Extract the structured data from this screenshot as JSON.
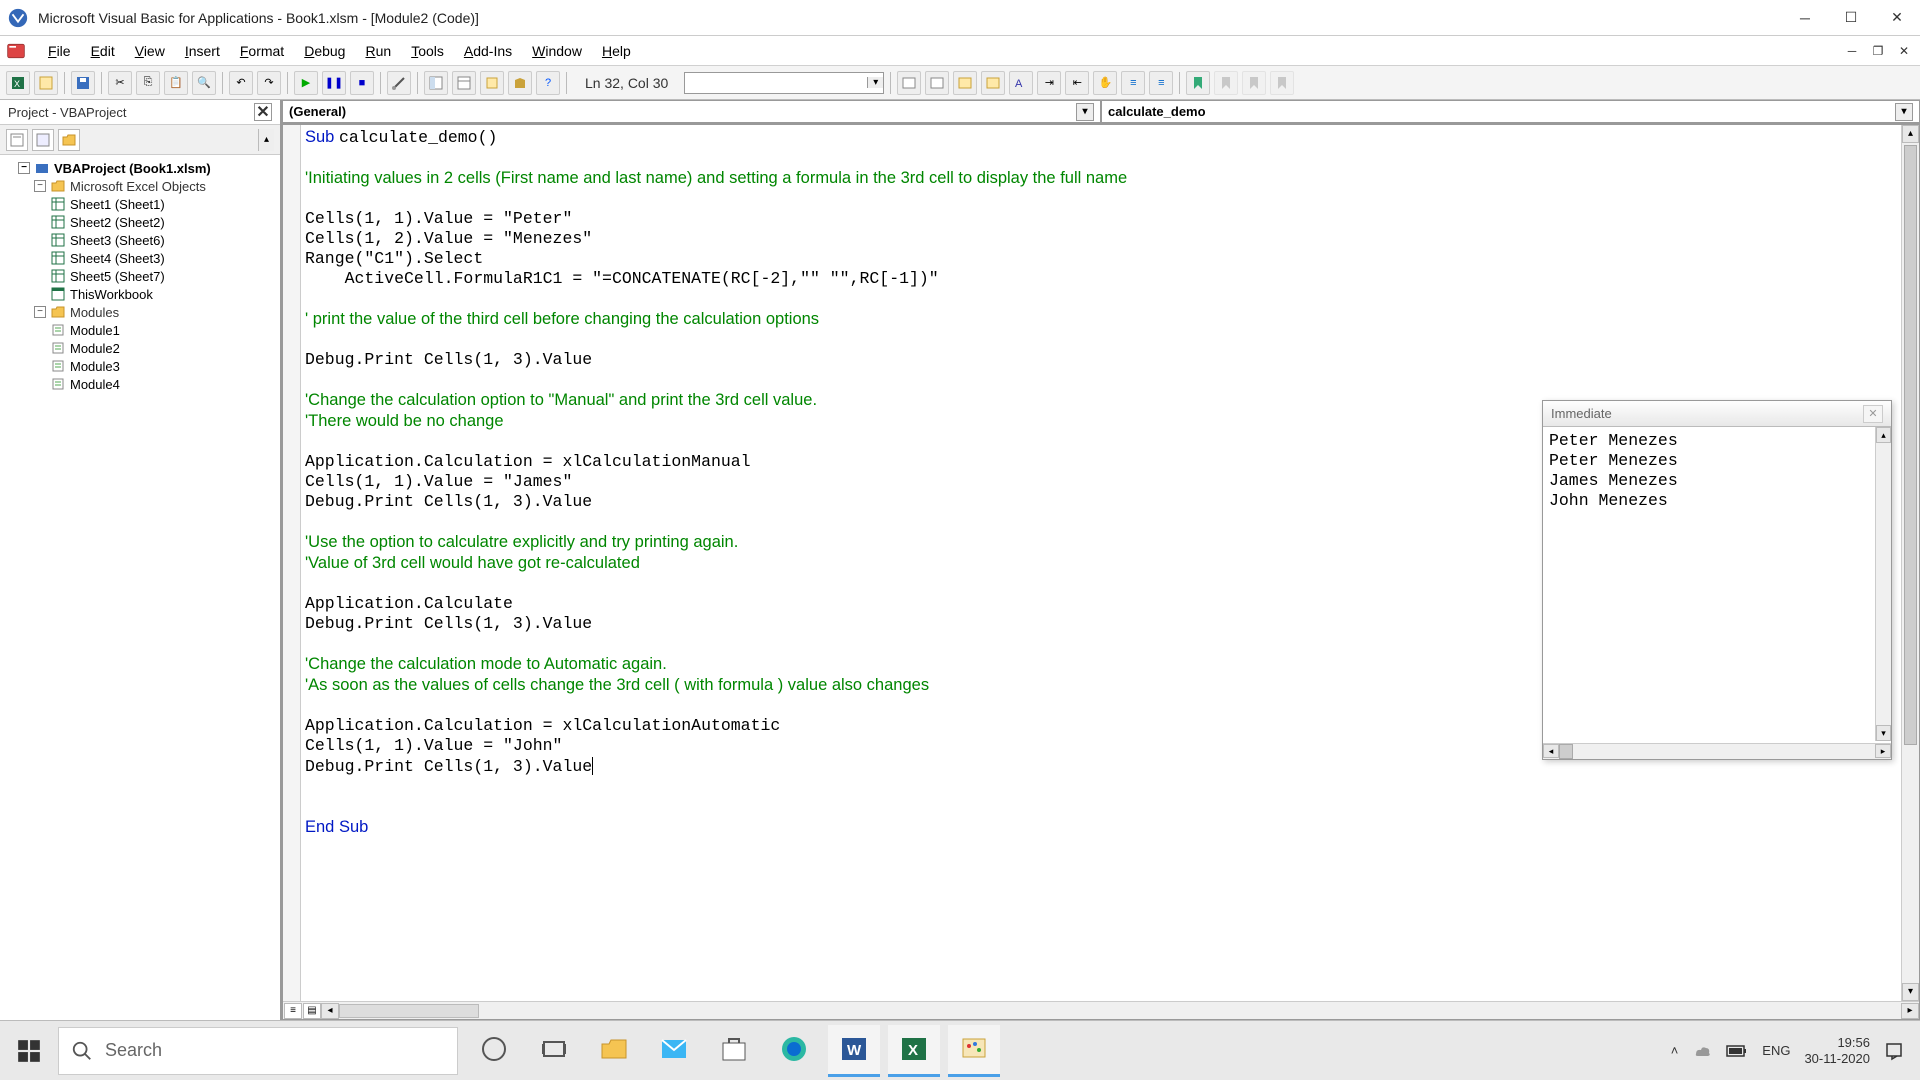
{
  "window": {
    "title": "Microsoft Visual Basic for Applications - Book1.xlsm - [Module2 (Code)]"
  },
  "menus": [
    "File",
    "Edit",
    "View",
    "Insert",
    "Format",
    "Debug",
    "Run",
    "Tools",
    "Add-Ins",
    "Window",
    "Help"
  ],
  "status": "Ln 32, Col 30",
  "project": {
    "panel_title": "Project - VBAProject",
    "root": "VBAProject (Book1.xlsm)",
    "excel_objects_label": "Microsoft Excel Objects",
    "sheets": [
      "Sheet1 (Sheet1)",
      "Sheet2 (Sheet2)",
      "Sheet3 (Sheet6)",
      "Sheet4 (Sheet3)",
      "Sheet5 (Sheet7)"
    ],
    "this_workbook": "ThisWorkbook",
    "modules_label": "Modules",
    "modules": [
      "Module1",
      "Module2",
      "Module3",
      "Module4"
    ]
  },
  "code_dropdowns": {
    "object": "(General)",
    "procedure": "calculate_demo"
  },
  "code_lines": [
    {
      "seg": [
        {
          "t": "Sub ",
          "c": "kw"
        },
        {
          "t": "calculate_demo()"
        }
      ]
    },
    {
      "seg": [
        {
          "t": ""
        }
      ]
    },
    {
      "seg": [
        {
          "t": "'Initiating values in 2 cells (First name and last name) and setting a formula in the 3rd cell to display the full name",
          "c": "cm"
        }
      ]
    },
    {
      "seg": [
        {
          "t": ""
        }
      ]
    },
    {
      "seg": [
        {
          "t": "Cells(1, 1).Value = \"Peter\""
        }
      ]
    },
    {
      "seg": [
        {
          "t": "Cells(1, 2).Value = \"Menezes\""
        }
      ]
    },
    {
      "seg": [
        {
          "t": "Range(\"C1\").Select"
        }
      ]
    },
    {
      "seg": [
        {
          "t": "    ActiveCell.FormulaR1C1 = \"=CONCATENATE(RC[-2],\"\" \"\",RC[-1])\""
        }
      ]
    },
    {
      "seg": [
        {
          "t": ""
        }
      ]
    },
    {
      "seg": [
        {
          "t": "' print the value of the third cell before changing the calculation options",
          "c": "cm"
        }
      ]
    },
    {
      "seg": [
        {
          "t": ""
        }
      ]
    },
    {
      "seg": [
        {
          "t": "Debug.Print Cells(1, 3).Value"
        }
      ]
    },
    {
      "seg": [
        {
          "t": ""
        }
      ]
    },
    {
      "seg": [
        {
          "t": "'Change the calculation option to \"Manual\" and print the 3rd cell value.",
          "c": "cm"
        }
      ]
    },
    {
      "seg": [
        {
          "t": "'There would be no change",
          "c": "cm"
        }
      ]
    },
    {
      "seg": [
        {
          "t": ""
        }
      ]
    },
    {
      "seg": [
        {
          "t": "Application.Calculation = xlCalculationManual"
        }
      ]
    },
    {
      "seg": [
        {
          "t": "Cells(1, 1).Value = \"James\""
        }
      ]
    },
    {
      "seg": [
        {
          "t": "Debug.Print Cells(1, 3).Value"
        }
      ]
    },
    {
      "seg": [
        {
          "t": ""
        }
      ]
    },
    {
      "seg": [
        {
          "t": "'Use the option to calculatre explicitly and try printing again.",
          "c": "cm"
        }
      ]
    },
    {
      "seg": [
        {
          "t": "'Value of 3rd cell would have got re-calculated",
          "c": "cm"
        }
      ]
    },
    {
      "seg": [
        {
          "t": ""
        }
      ]
    },
    {
      "seg": [
        {
          "t": "Application.Calculate"
        }
      ]
    },
    {
      "seg": [
        {
          "t": "Debug.Print Cells(1, 3).Value"
        }
      ]
    },
    {
      "seg": [
        {
          "t": ""
        }
      ]
    },
    {
      "seg": [
        {
          "t": "'Change the calculation mode to Automatic again.",
          "c": "cm"
        }
      ]
    },
    {
      "seg": [
        {
          "t": "'As soon as the values of cells change the 3rd cell ( with formula ) value also changes",
          "c": "cm"
        }
      ]
    },
    {
      "seg": [
        {
          "t": ""
        }
      ]
    },
    {
      "seg": [
        {
          "t": "Application.Calculation = xlCalculationAutomatic"
        }
      ]
    },
    {
      "seg": [
        {
          "t": "Cells(1, 1).Value = \"John\""
        }
      ]
    },
    {
      "seg": [
        {
          "t": "Debug.Print Cells(1, 3).Value"
        }
      ],
      "cursor": true
    },
    {
      "seg": [
        {
          "t": ""
        }
      ]
    },
    {
      "seg": [
        {
          "t": ""
        }
      ]
    },
    {
      "seg": [
        {
          "t": "End Sub",
          "c": "kw"
        }
      ]
    }
  ],
  "immediate": {
    "title": "Immediate",
    "lines": [
      "Peter Menezes",
      "Peter Menezes",
      "James Menezes",
      "John Menezes"
    ]
  },
  "taskbar": {
    "search_placeholder": "Search",
    "lang": "ENG",
    "time": "19:56",
    "date": "30-11-2020"
  }
}
